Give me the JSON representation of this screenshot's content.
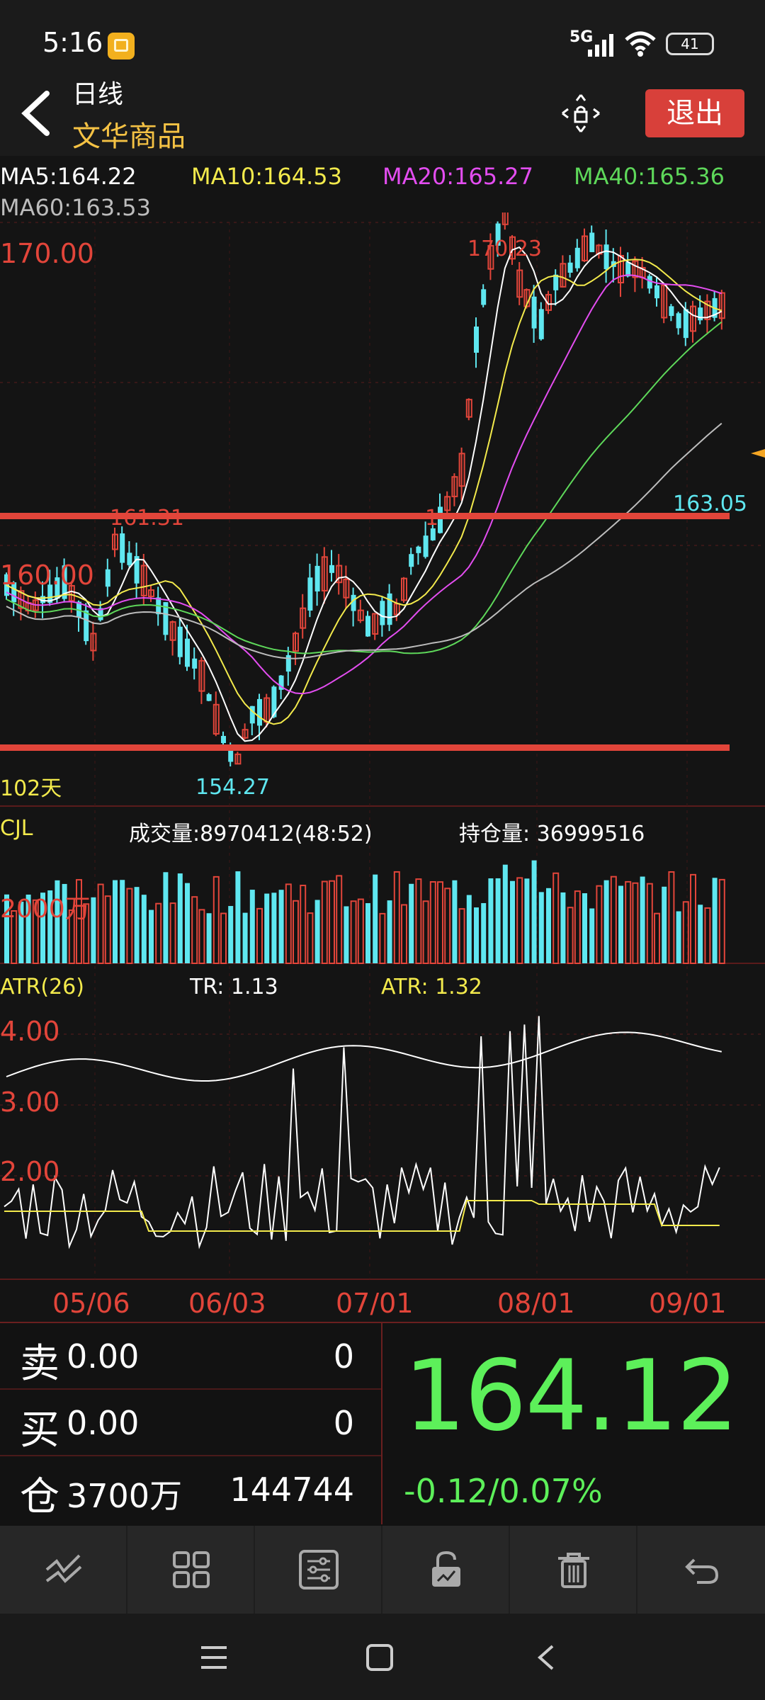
{
  "status": {
    "time": "5:16",
    "network": "5G",
    "battery": "41"
  },
  "header": {
    "period": "日线",
    "instrument": "文华商品",
    "exit_label": "退出"
  },
  "ma_legend": [
    {
      "label": "MA5:164.22",
      "color": "#ffffff"
    },
    {
      "label": "MA10:164.53",
      "color": "#f3ea4c"
    },
    {
      "label": "MA20:165.27",
      "color": "#e34df0"
    },
    {
      "label": "MA40:165.36",
      "color": "#5ed85a"
    },
    {
      "label": "MA60:163.53",
      "color": "#bdbdbd"
    }
  ],
  "price_chart": {
    "y_labels": [
      "170.00",
      "160.00"
    ],
    "high_label": "170.23",
    "low_label": "154.27",
    "mark_161": "161.31",
    "mark_163": "163.05",
    "mark_left_1": "1",
    "days_label": "102天"
  },
  "volume": {
    "name": "CJL",
    "turnover": "成交量:8970412(48:52)",
    "open_interest": "持仓量: 36999516",
    "scale_label": "2000万"
  },
  "atr": {
    "name": "ATR(26)",
    "tr": "TR: 1.13",
    "atr": "ATR: 1.32",
    "y_labels": [
      "4.00",
      "3.00",
      "2.00"
    ]
  },
  "x_axis": [
    "05/06",
    "06/03",
    "07/01",
    "08/01",
    "09/01"
  ],
  "quote": {
    "sell_label": "卖",
    "sell_price": "0.00",
    "sell_qty": "0",
    "buy_label": "买",
    "buy_price": "0.00",
    "buy_qty": "0",
    "oi_label": "仓",
    "oi_value": "3700万",
    "oi_qty": "144744",
    "last": "164.12",
    "change": "-0.12/0.07%"
  },
  "colors": {
    "up": "#e2453a",
    "down": "#5fe7f0",
    "bg": "#141414",
    "green": "#5df05a",
    "accent": "#f5c244"
  },
  "toolbar_icons": [
    "draw-line-icon",
    "grid-icon",
    "settings-sliders-icon",
    "unlock-icon",
    "trash-icon",
    "undo-icon"
  ],
  "nav_icons": [
    "menu-icon",
    "home-square-icon",
    "back-chevron-icon"
  ]
}
